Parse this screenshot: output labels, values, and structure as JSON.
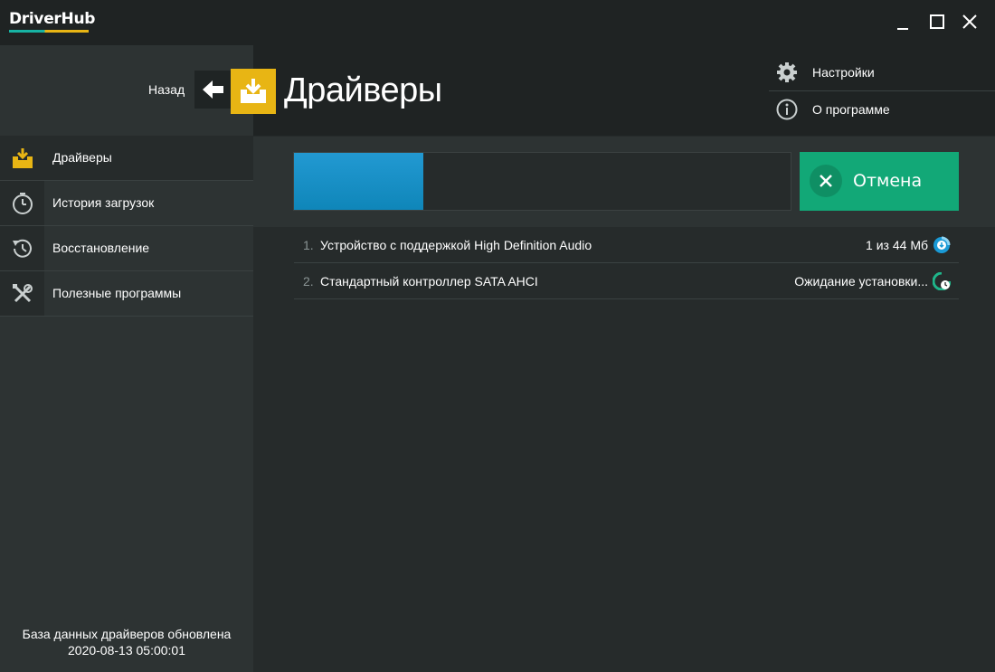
{
  "app": {
    "name": "DriverHub",
    "colors": {
      "accent_yellow": "#e8b514",
      "accent_teal": "#17b3a3",
      "progress_blue": "#1a8fc7",
      "cancel_green": "#12a877"
    }
  },
  "window_controls": {
    "minimize": "minimize-icon",
    "maximize": "maximize-icon",
    "close": "close-icon"
  },
  "header": {
    "back_label": "Назад",
    "title": "Драйверы",
    "settings_label": "Настройки",
    "about_label": "О программе"
  },
  "sidebar": {
    "items": [
      {
        "label": "Драйверы",
        "icon": "download-tray-icon",
        "active": true
      },
      {
        "label": "История загрузок",
        "icon": "stopwatch-icon",
        "active": false
      },
      {
        "label": "Восстановление",
        "icon": "restore-history-icon",
        "active": false
      },
      {
        "label": "Полезные программы",
        "icon": "tools-icon",
        "active": false
      }
    ],
    "db_status_line1": "База данных драйверов обновлена",
    "db_status_line2": "2020-08-13 05:00:01"
  },
  "progress": {
    "fraction": 0.26
  },
  "cancel_button": {
    "label": "Отмена"
  },
  "downloads": [
    {
      "num": "1.",
      "name": "Устройство с поддержкой High Definition Audio",
      "status": "1 из 44 Мб",
      "icon": "downloading-icon"
    },
    {
      "num": "2.",
      "name": "Стандартный контроллер SATA AHCI",
      "status": "Ожидание установки...",
      "icon": "pending-install-icon"
    }
  ]
}
